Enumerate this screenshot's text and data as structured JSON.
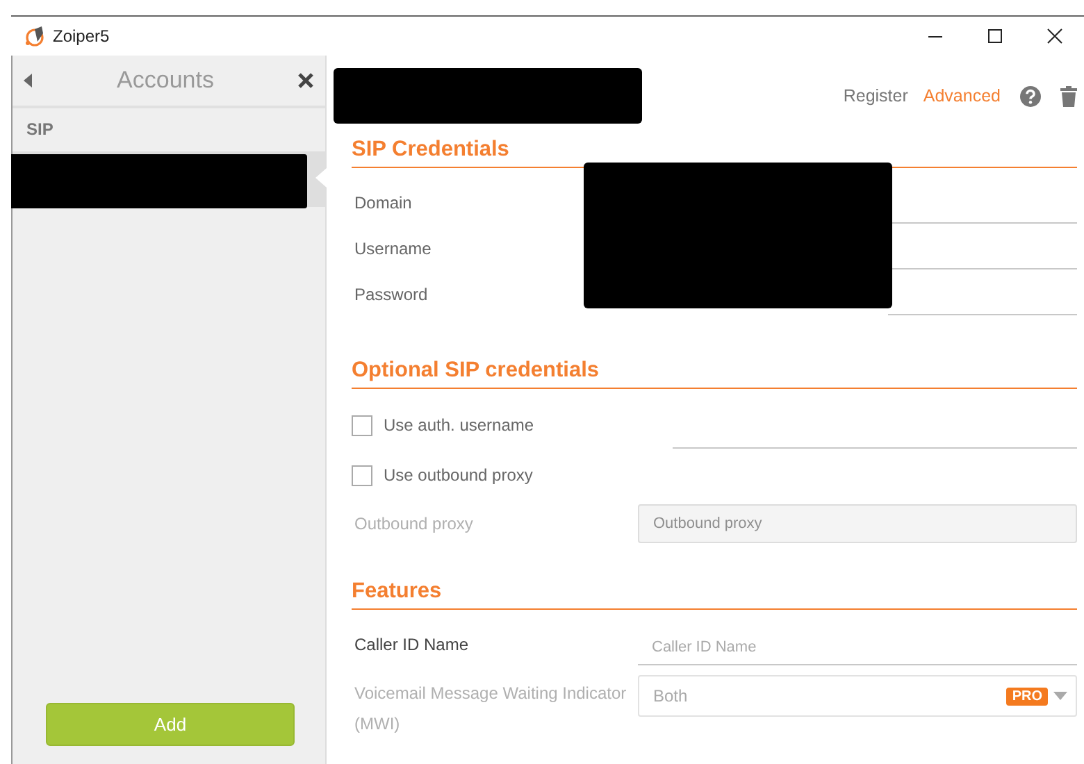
{
  "window": {
    "title": "Zoiper5"
  },
  "sidebar": {
    "title": "Accounts",
    "section": "SIP",
    "accounts": [
      {
        "redacted": true,
        "selected": true
      }
    ],
    "add_button": "Add"
  },
  "header": {
    "name_redacted": true,
    "links": [
      {
        "label": "Register",
        "active": false
      },
      {
        "label": "Advanced",
        "active": true
      }
    ]
  },
  "sections": [
    {
      "title": "SIP Credentials",
      "values_redacted": true,
      "fields": [
        {
          "kind": "text",
          "label": "Domain",
          "disabled": false
        },
        {
          "kind": "text",
          "label": "Username",
          "disabled": false
        },
        {
          "kind": "text",
          "label": "Password",
          "disabled": false
        }
      ]
    },
    {
      "title": "Optional SIP credentials",
      "fields": [
        {
          "kind": "checkbox",
          "label": "Use auth. username",
          "checked": false,
          "with_field": true
        },
        {
          "kind": "checkbox",
          "label": "Use outbound proxy",
          "checked": false,
          "with_field": false
        },
        {
          "kind": "text",
          "label": "Outbound proxy",
          "placeholder": "Outbound proxy",
          "disabled": true
        }
      ]
    },
    {
      "title": "Features",
      "fields": [
        {
          "kind": "text",
          "label": "Caller ID Name",
          "placeholder": "Caller ID Name",
          "disabled": false
        },
        {
          "kind": "select",
          "label": "Voicemail Message Waiting Indicator (MWI)",
          "value": "Both",
          "badge": "PRO",
          "disabled": true
        }
      ]
    }
  ]
}
